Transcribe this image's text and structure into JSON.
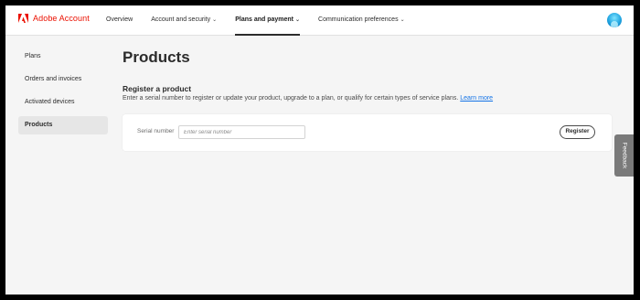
{
  "header": {
    "brand": "Adobe Account",
    "nav": [
      {
        "label": "Overview",
        "chevron": false
      },
      {
        "label": "Account and security",
        "chevron": true
      },
      {
        "label": "Plans and payment",
        "chevron": true,
        "active": true
      },
      {
        "label": "Communication preferences",
        "chevron": true
      }
    ],
    "brand_color": "#eb1000"
  },
  "sidebar": {
    "items": [
      {
        "label": "Plans"
      },
      {
        "label": "Orders and invoices"
      },
      {
        "label": "Activated devices"
      },
      {
        "label": "Products",
        "active": true
      }
    ]
  },
  "main": {
    "title": "Products",
    "section_title": "Register a product",
    "section_desc": "Enter a serial number to register or update your product, upgrade to a plan, or qualify for certain types of service plans.",
    "learn_more": "Learn more",
    "serial_label": "Serial number",
    "serial_placeholder": "Enter serial number",
    "serial_value": "",
    "register_label": "Register"
  },
  "feedback_label": "Feedback",
  "colors": {
    "link": "#1473e6",
    "background": "#f5f5f5"
  }
}
